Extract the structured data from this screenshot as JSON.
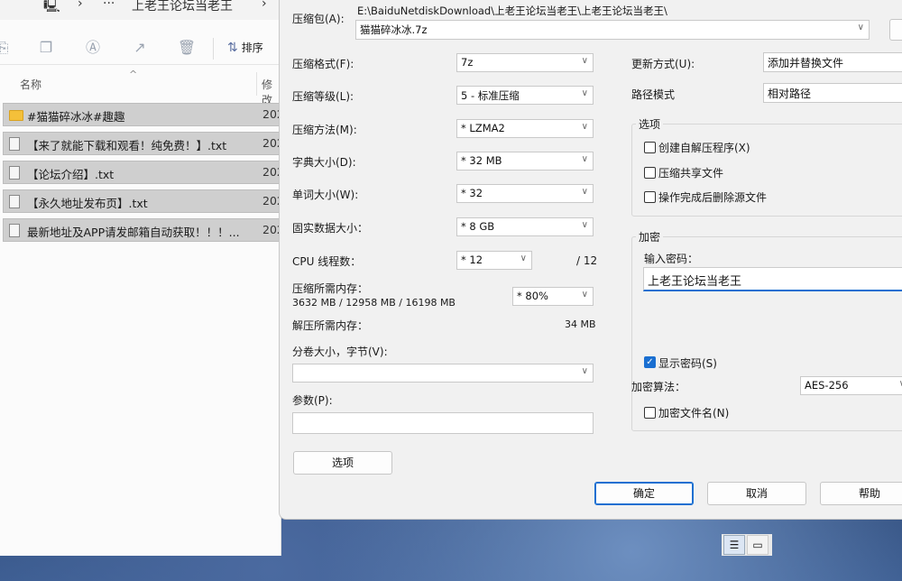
{
  "explorer": {
    "breadcrumb_more": "···",
    "breadcrumb_folder": "上老王论坛当老王",
    "sort_label": "排序",
    "col_name": "名称",
    "col_modified": "修改",
    "files": [
      {
        "name": "#猫猫碎冰冰#趣趣",
        "date": "202",
        "type": "folder"
      },
      {
        "name": "【来了就能下载和观看！纯免费！】.txt",
        "date": "202",
        "type": "txt"
      },
      {
        "name": "【论坛介绍】.txt",
        "date": "202",
        "type": "txt"
      },
      {
        "name": "【永久地址发布页】.txt",
        "date": "202",
        "type": "txt"
      },
      {
        "name": "最新地址及APP请发邮箱自动获取！！！...",
        "date": "202",
        "type": "txt"
      }
    ]
  },
  "dialog": {
    "archive_label": "压缩包(A):",
    "archive_path": "E:\\BaiduNetdiskDownload\\上老王论坛当老王\\上老王论坛当老王\\",
    "archive_name": "猫猫碎冰冰.7z",
    "format_label": "压缩格式(F):",
    "format_value": "7z",
    "level_label": "压缩等级(L):",
    "level_value": "5 - 标准压缩",
    "method_label": "压缩方法(M):",
    "method_value": "* LZMA2",
    "dict_label": "字典大小(D):",
    "dict_value": "* 32 MB",
    "word_label": "单词大小(W):",
    "word_value": "* 32",
    "solid_label": "固实数据大小：",
    "solid_value": "* 8 GB",
    "cpu_label": "CPU 线程数：",
    "cpu_value": "* 12",
    "cpu_total": "/ 12",
    "mem_compress_label": "压缩所需内存：",
    "mem_compress_detail": "3632 MB / 12958 MB / 16198 MB",
    "mem_percent": "* 80%",
    "mem_decompress_label": "解压所需内存：",
    "mem_decompress_value": "34 MB",
    "volume_label": "分卷大小，字节(V):",
    "volume_value": "",
    "params_label": "参数(P):",
    "params_value": "",
    "options_button": "选项",
    "update_label": "更新方式(U):",
    "update_value": "添加并替换文件",
    "path_label": "路径模式",
    "path_value": "相对路径",
    "options_group": "选项",
    "opt_sfx": "创建自解压程序(X)",
    "opt_shared": "压缩共享文件",
    "opt_delete": "操作完成后删除源文件",
    "encrypt_group": "加密",
    "password_label": "输入密码：",
    "password_value": "上老王论坛当老王",
    "show_password": "显示密码(S)",
    "encrypt_method_label": "加密算法：",
    "encrypt_method_value": "AES-256",
    "encrypt_names": "加密文件名(N)",
    "ok_button": "确定",
    "cancel_button": "取消",
    "help_button": "帮助"
  }
}
